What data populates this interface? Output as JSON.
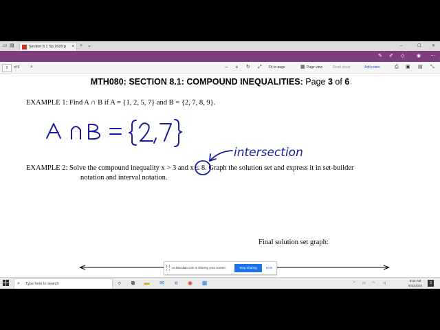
{
  "browser": {
    "tab_title": "Section 8.1 Sp 2020.p",
    "tab_close": "×",
    "new_tab": "+",
    "tab_menu": "⌄",
    "win_min": "–",
    "win_max": "☐",
    "win_close": "✕"
  },
  "pdf_toolbar": {
    "page_number": "3",
    "page_total": "of 6",
    "zoom_out": "−",
    "zoom_in": "+",
    "fit_label": "Fit to page",
    "view_label": "Page view",
    "read_aloud_label": "Read aloud",
    "add_notes_label": "Add notes"
  },
  "document": {
    "title_main": "MTH080: SECTION  8.1: COMPOUND INEQUALITIES: ",
    "title_page_word": "Page ",
    "title_page_num": "3",
    "title_of": " of ",
    "title_total": "6",
    "example1": "EXAMPLE 1:  Find A ∩ B if A = {1, 2, 5, 7} and B = {2, 7, 8, 9}.",
    "example2_line1": "EXAMPLE 2:  Solve the compound inequality  x > 3  and  x ≤ 8.  Graph the solution set and express it in set-builder",
    "example2_line2": "notation and interval notation.",
    "final_label": "Final solution set graph:",
    "handwritten_answer": "A ∩ B = {2, 7}",
    "handwritten_note": "intersection"
  },
  "share_bar": {
    "message": "us.bbcollab.com is sharing your screen.",
    "stop_label": "Stop sharing",
    "hide_label": "Hide"
  },
  "taskbar": {
    "search_placeholder": "Type here to search",
    "time": "8:34 AM",
    "date": "6/10/2020",
    "notification_count": "3"
  },
  "colors": {
    "pdf_accent": "#7d3d7f",
    "ink": "#1a1aa0",
    "stop_button": "#1a73e8"
  }
}
